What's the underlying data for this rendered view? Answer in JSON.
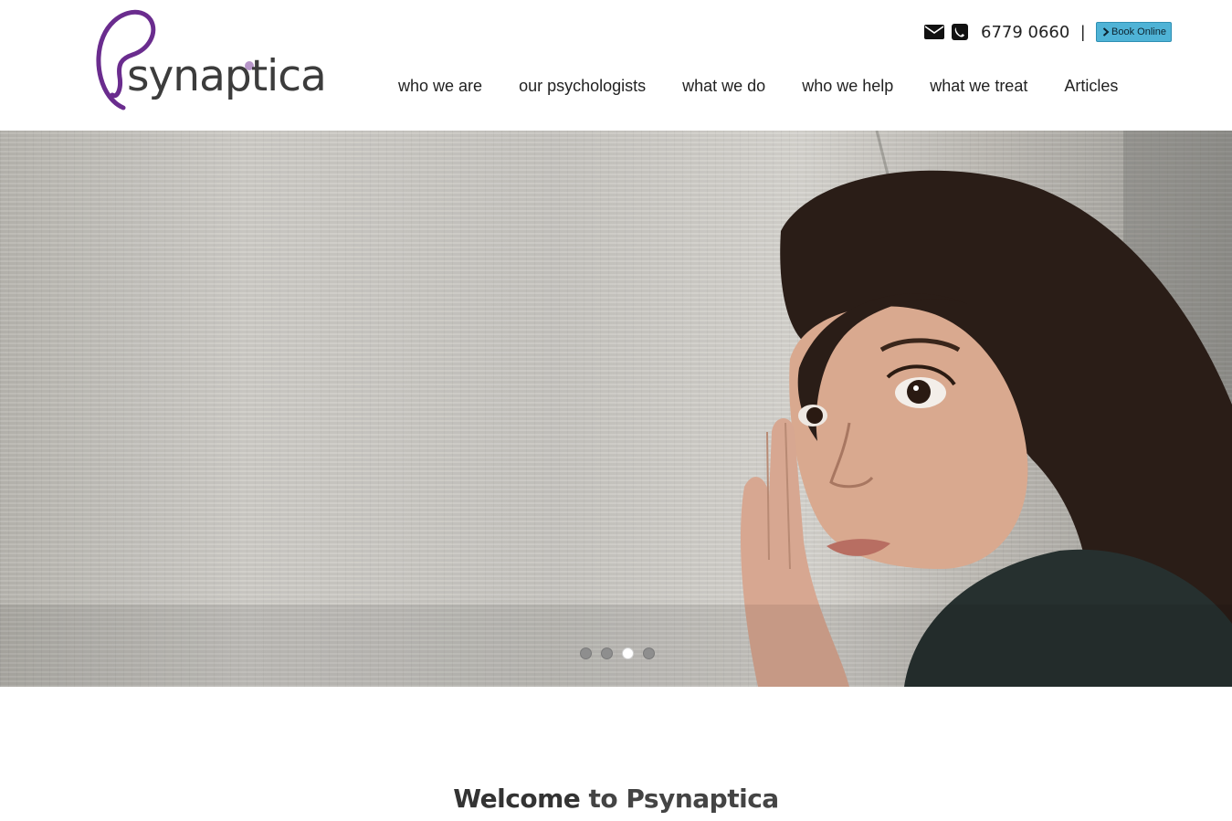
{
  "header": {
    "logo": {
      "wordmark": "synaptica",
      "initial": "P",
      "accent_color": "#6a2c8e"
    },
    "contact": {
      "email_icon": "envelope-icon",
      "phone_icon": "phone-icon",
      "phone": "6779 0660",
      "separator": "|",
      "book_icon": "chevron-right-icon",
      "book_label": "Book Online",
      "book_color": "#4fb3d6"
    },
    "nav": [
      {
        "label": "who we are"
      },
      {
        "label": "our psychologists"
      },
      {
        "label": "what we do"
      },
      {
        "label": "who we help"
      },
      {
        "label": "what we treat"
      },
      {
        "label": "Articles"
      }
    ]
  },
  "hero": {
    "slide_count": 4,
    "active_slide": 3
  },
  "welcome": {
    "strong": "Welcome",
    "rest": " to Psynaptica"
  }
}
